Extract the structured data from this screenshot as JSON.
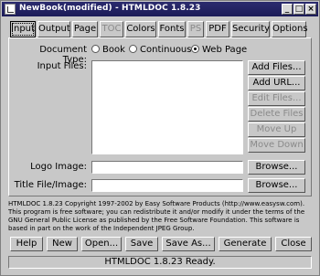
{
  "window": {
    "title": "NewBook(modified) - HTMLDOC 1.8.23",
    "controls": [
      "_",
      "□",
      "×"
    ]
  },
  "tabs": [
    {
      "label": "Input",
      "active": true,
      "disabled": false
    },
    {
      "label": "Output",
      "active": false,
      "disabled": false
    },
    {
      "label": "Page",
      "active": false,
      "disabled": false
    },
    {
      "label": "TOC",
      "active": false,
      "disabled": true
    },
    {
      "label": "Colors",
      "active": false,
      "disabled": false
    },
    {
      "label": "Fonts",
      "active": false,
      "disabled": false
    },
    {
      "label": "PS",
      "active": false,
      "disabled": true
    },
    {
      "label": "PDF",
      "active": false,
      "disabled": false
    },
    {
      "label": "Security",
      "active": false,
      "disabled": false
    },
    {
      "label": "Options",
      "active": false,
      "disabled": false
    }
  ],
  "input": {
    "document_type_label": "Document Type:",
    "document_types": [
      {
        "label": "Book",
        "selected": false
      },
      {
        "label": "Continuous",
        "selected": false
      },
      {
        "label": "Web Page",
        "selected": true
      }
    ],
    "input_files_label": "Input Files:",
    "file_buttons": [
      {
        "label": "Add Files...",
        "disabled": false
      },
      {
        "label": "Add URL...",
        "disabled": false
      },
      {
        "label": "Edit Files...",
        "disabled": true
      },
      {
        "label": "Delete Files",
        "disabled": true
      },
      {
        "label": "Move Up",
        "disabled": true
      },
      {
        "label": "Move Down",
        "disabled": true
      }
    ],
    "logo_image_label": "Logo Image:",
    "logo_image_value": "",
    "logo_browse": "Browse...",
    "title_image_label": "Title File/Image:",
    "title_image_value": "",
    "title_browse": "Browse..."
  },
  "info_text": "HTMLDOC 1.8.23 Copyright 1997-2002 by Easy Software Products (http://www.easysw.com). This program is free software; you can redistribute it and/or modify it under the terms of the GNU General Public License as published by the Free Software Foundation. This software is based in part on the work of the Independent JPEG Group.",
  "bottom_buttons": {
    "help": "Help",
    "new": "New",
    "open": "Open...",
    "save": "Save",
    "save_as": "Save As...",
    "generate": "Generate",
    "close": "Close"
  },
  "status": "HTMLDOC 1.8.23 Ready."
}
